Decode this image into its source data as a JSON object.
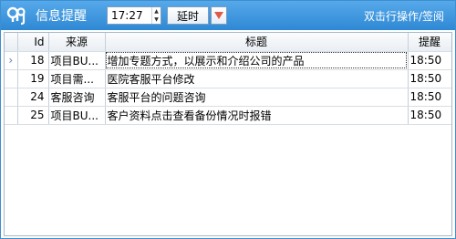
{
  "titlebar": {
    "title": "信息提醒",
    "time_value": "17:27",
    "delay_label": "延时",
    "hint": "双击行操作/签阅",
    "spin_up": "▲",
    "spin_down": "▼"
  },
  "grid": {
    "current_row_marker": "›",
    "columns": [
      "Id",
      "来源",
      "标题",
      "提醒"
    ],
    "rows": [
      {
        "id": "18",
        "source": "项目BU...",
        "title": "增加专题方式，以展示和介绍公司的产品",
        "remind": "18:50"
      },
      {
        "id": "19",
        "source": "项目需...",
        "title": "医院客服平台修改",
        "remind": "18:50"
      },
      {
        "id": "24",
        "source": "客服咨询",
        "title": "客服平台的问题咨询",
        "remind": "18:50"
      },
      {
        "id": "25",
        "source": "项目BU...",
        "title": "客户资料点击查看备份情况时报错",
        "remind": "18:50"
      }
    ]
  },
  "colors": {
    "titlebar": "#3b95dd",
    "dropdown_arrow": "#e05a4a",
    "logo": "#ffffff"
  }
}
